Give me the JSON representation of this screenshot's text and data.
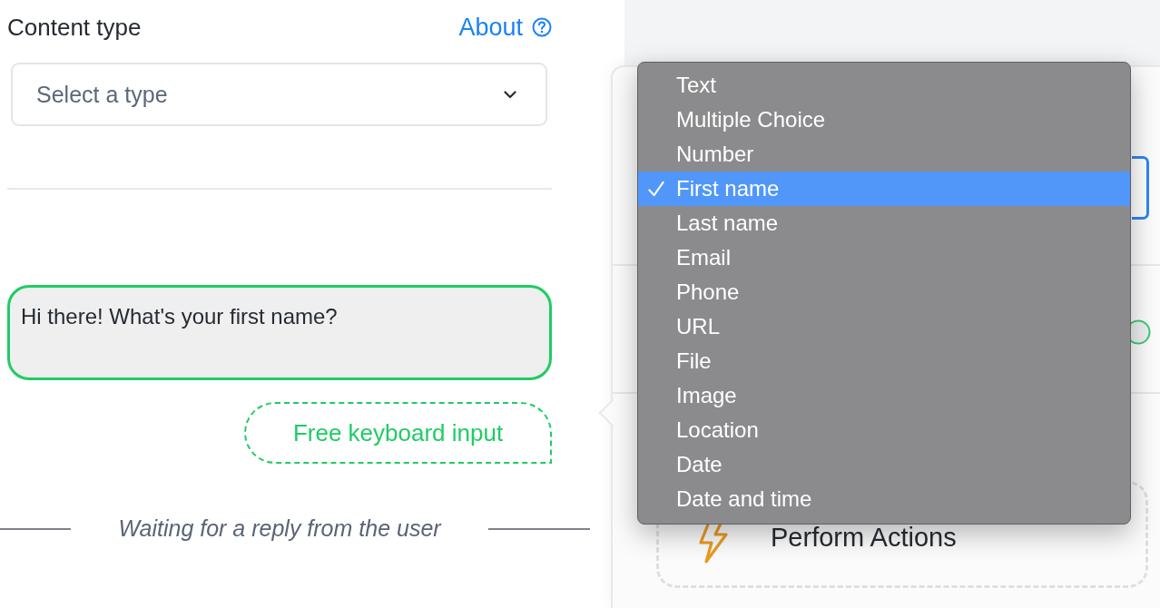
{
  "content_type": {
    "title": "Content type",
    "about_link": "About",
    "type_select": {
      "placeholder": "Select a type"
    }
  },
  "conversation": {
    "bot_message": "Hi there! What's your first name?",
    "reply_option": "Free keyboard input",
    "waiting_note": "Waiting for a reply from the user"
  },
  "side_card": {
    "action_block": "Perform Actions"
  },
  "type_menu": {
    "items": [
      {
        "label": "Text",
        "selected": false
      },
      {
        "label": "Multiple Choice",
        "selected": false
      },
      {
        "label": "Number",
        "selected": false
      },
      {
        "label": "First name",
        "selected": true
      },
      {
        "label": "Last name",
        "selected": false
      },
      {
        "label": "Email",
        "selected": false
      },
      {
        "label": "Phone",
        "selected": false
      },
      {
        "label": "URL",
        "selected": false
      },
      {
        "label": "File",
        "selected": false
      },
      {
        "label": "Image",
        "selected": false
      },
      {
        "label": "Location",
        "selected": false
      },
      {
        "label": "Date",
        "selected": false
      },
      {
        "label": "Date and time",
        "selected": false
      }
    ]
  }
}
